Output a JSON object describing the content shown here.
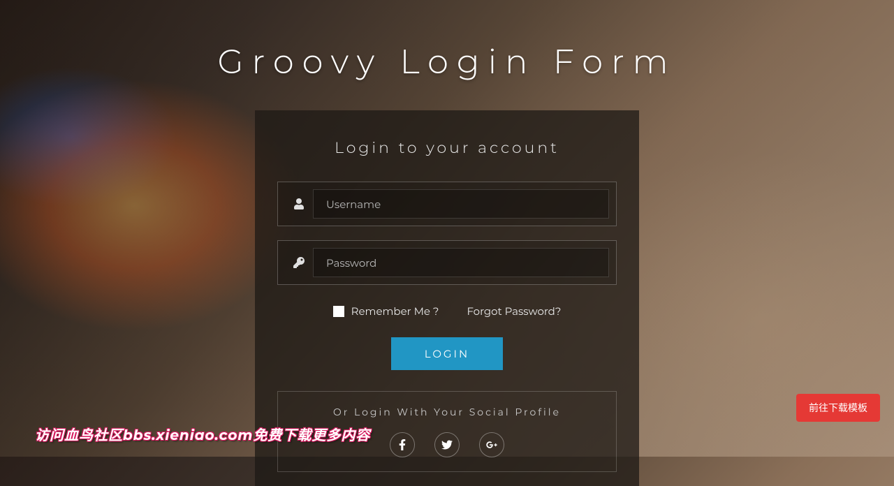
{
  "page": {
    "title": "Groovy Login Form"
  },
  "card": {
    "title": "Login to your account",
    "username_placeholder": "Username",
    "password_placeholder": "Password",
    "remember_label": "Remember Me ?",
    "forgot_label": "Forgot Password?",
    "login_button": "LOGIN"
  },
  "social": {
    "title": "Or Login With Your Social Profile"
  },
  "download_button": "前往下载模板",
  "watermark": "访问血鸟社区bbs.xieniao.com免费下载更多内容"
}
